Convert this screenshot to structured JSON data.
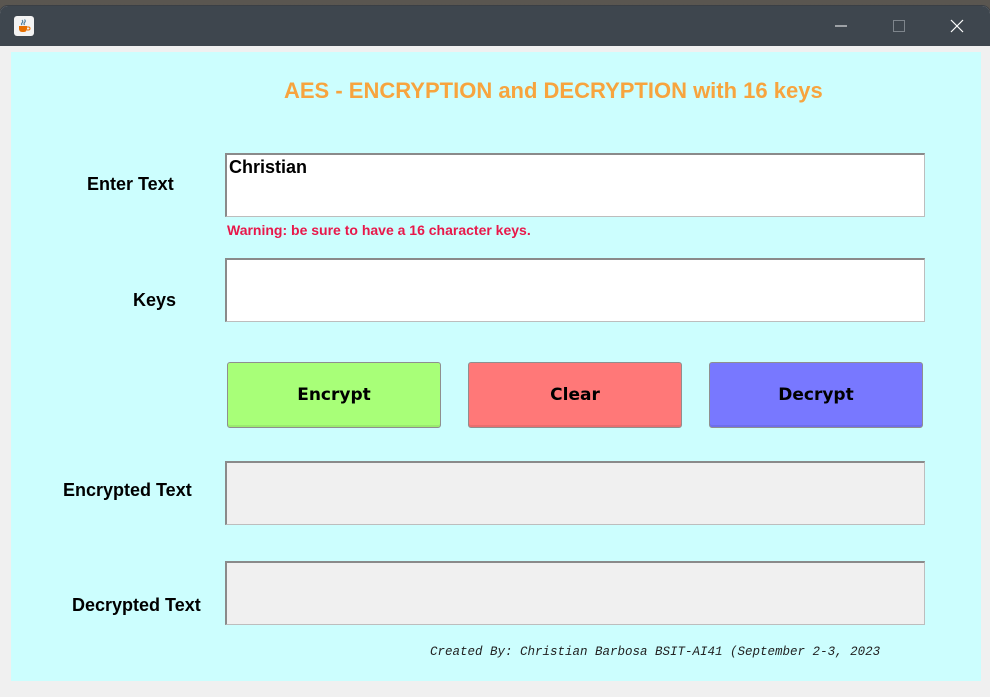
{
  "window": {
    "title": "",
    "icons": {
      "app": "java-cup-icon",
      "minimize": "minimize-icon",
      "maximize": "maximize-icon",
      "close": "close-icon"
    }
  },
  "form": {
    "heading": "AES - ENCRYPTION and DECRYPTION with 16 keys",
    "enter_text_label": "Enter Text",
    "enter_text_value": "Christian",
    "warning": "Warning: be sure to have a 16 character keys.",
    "keys_label": "Keys",
    "keys_value": "",
    "encrypted_label": "Encrypted Text",
    "encrypted_value": "",
    "decrypted_label": "Decrypted Text",
    "decrypted_value": ""
  },
  "buttons": {
    "encrypt": {
      "label": "Encrypt",
      "color": "#a8ff78"
    },
    "clear": {
      "label": "Clear",
      "color": "#ff7878"
    },
    "decrypt": {
      "label": "Decrypt",
      "color": "#7878ff"
    }
  },
  "footer": {
    "credit": "Created By: Christian Barbosa BSIT-AI41 (September 2-3, 2023"
  },
  "colors": {
    "panel": "#ccfefe",
    "heading": "#f7a43e",
    "warning": "#e8184a",
    "titlebar": "#3e464e"
  }
}
